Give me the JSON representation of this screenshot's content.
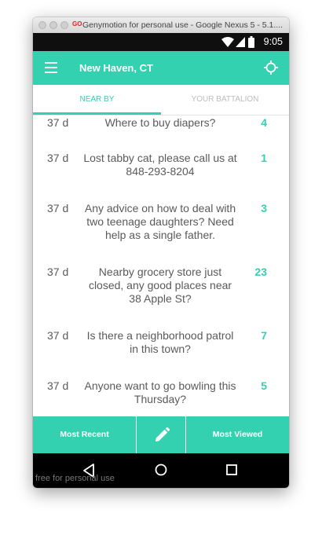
{
  "window": {
    "title": "Genymotion for personal use - Google Nexus 5 - 5.1....",
    "logo_text": "GO"
  },
  "status_bar": {
    "time": "9:05"
  },
  "app_bar": {
    "location": "New Haven, CT"
  },
  "tabs": [
    {
      "label": "NEAR BY",
      "active": true
    },
    {
      "label": "YOUR BATTALION",
      "active": false
    }
  ],
  "posts": [
    {
      "age": "37 d",
      "text": "Where to buy diapers?",
      "count": "4"
    },
    {
      "age": "37 d",
      "text": "Lost tabby cat, please call us at 848-293-8204",
      "count": "1"
    },
    {
      "age": "37 d",
      "text": "Any advice on how to deal with two teenage daughters? Need help as a single father.",
      "count": "3"
    },
    {
      "age": "37 d",
      "text": "Nearby grocery store just closed, any good places near 38 Apple St?",
      "count": "23"
    },
    {
      "age": "37 d",
      "text": "Is there a neighborhood patrol in this town?",
      "count": "7"
    },
    {
      "age": "37 d",
      "text": "Anyone want to go bowling this Thursday?",
      "count": "5"
    }
  ],
  "bottom_bar": {
    "left_label": "Most Recent",
    "right_label": "Most Viewed"
  },
  "nav_bar": {
    "watermark": "free for personal use"
  },
  "colors": {
    "accent": "#33d1b0",
    "text": "#5a5a5a",
    "status_bar": "#0f0f0f",
    "nav_bar": "#000000"
  },
  "icons": [
    "menu-icon",
    "crosshair-icon",
    "wifi-icon",
    "signal-icon",
    "battery-icon",
    "pencil-icon",
    "back-icon",
    "home-icon",
    "recents-icon"
  ]
}
